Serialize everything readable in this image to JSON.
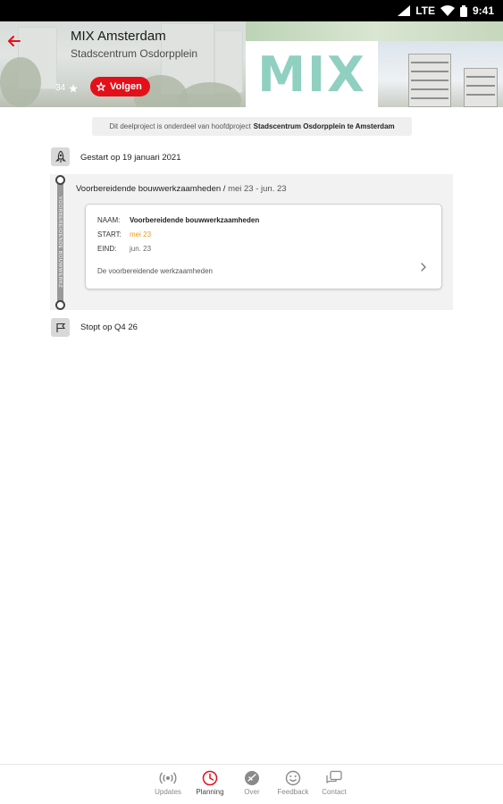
{
  "status_bar": {
    "network": "LTE",
    "time": "9:41"
  },
  "header": {
    "title": "MIX Amsterdam",
    "subtitle": "Stadscentrum Osdorpplein",
    "follower_count": "34",
    "follow_label": "Volgen",
    "logo_text": "MIX",
    "back_icon": "arrow-left-icon"
  },
  "info_chip": {
    "prefix": "Dit deelproject is onderdeel van hoofdproject",
    "parent_project": "Stadscentrum Osdorpplein te Amsterdam"
  },
  "timeline": {
    "start_label": "Gestart op 19 januari 2021",
    "start_icon": "rocket-icon",
    "end_label": "Stopt op Q4 26",
    "end_icon": "flag-icon",
    "phase": {
      "vertical_label": "VOORBEREIDENDE BOUWWERKZ",
      "title": "Voorbereidende bouwwerkzaamheden",
      "separator": " / ",
      "dates": "mei 23 - jun. 23",
      "card": {
        "name_key": "NAAM:",
        "name_value": "Voorbereidende bouwwerkzaamheden",
        "start_key": "START:",
        "start_value": "mei 23",
        "end_key": "EIND:",
        "end_value": "jun. 23",
        "description": "De voorbereidende werkzaamheden",
        "highlight_color": "#e89a1c"
      }
    }
  },
  "bottom_nav": {
    "active_color": "#e3101a",
    "items": [
      {
        "label": "Updates",
        "icon": "broadcast-icon"
      },
      {
        "label": "Planning",
        "icon": "clock-icon"
      },
      {
        "label": "Over",
        "icon": "info-icon"
      },
      {
        "label": "Feedback",
        "icon": "smiley-icon"
      },
      {
        "label": "Contact",
        "icon": "chat-icon"
      }
    ]
  }
}
